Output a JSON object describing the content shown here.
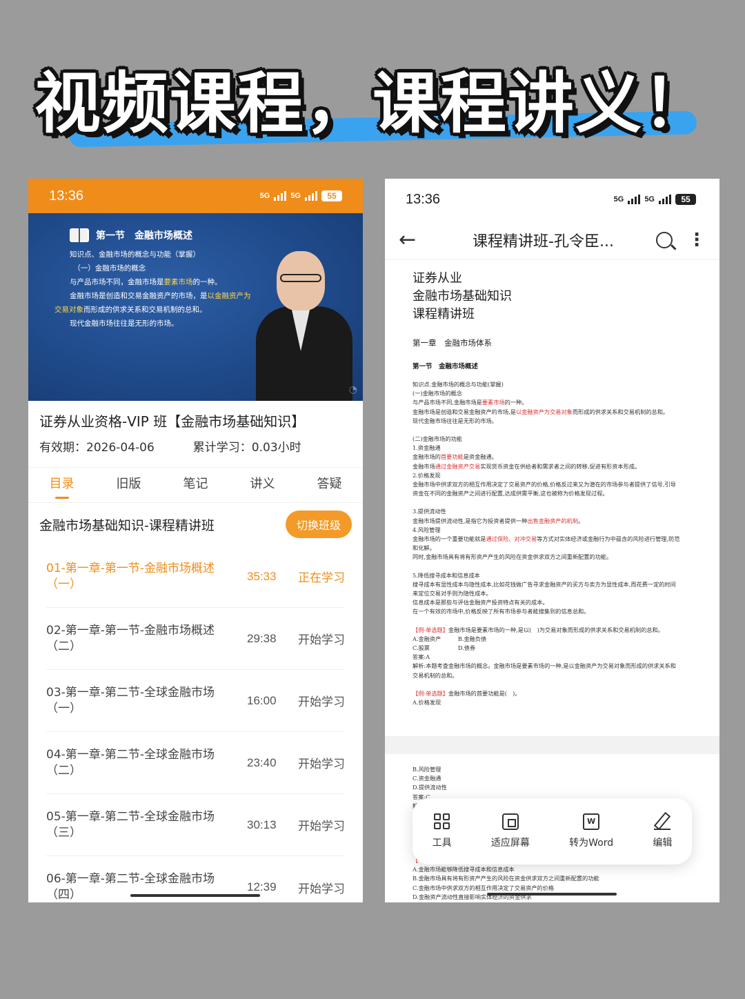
{
  "headline": "视频课程，课程讲义！",
  "left": {
    "status": {
      "time": "13:36",
      "network": "5G",
      "battery": "55"
    },
    "video": {
      "section_title": "第一节　金融市场概述",
      "lines": [
        {
          "pre": "知识点、金融市场的概念与功能（掌握）",
          "hl": "",
          "post": ""
        },
        {
          "pre": "　（一）金融市场的概念",
          "hl": "",
          "post": ""
        },
        {
          "pre": "与产品市场不同，金融市场是",
          "hl": "要素市场",
          "post": "的一种。"
        },
        {
          "pre": "金融市场是创造和交易金融资产的市场，是",
          "hl": "以金融资产为",
          "post": ""
        },
        {
          "pre": "",
          "hl": "交易对象",
          "post": "而形成的供求关系和交易机制的总和。"
        },
        {
          "pre": "现代金融市场往往是无形的市场。",
          "hl": "",
          "post": ""
        }
      ]
    },
    "course": {
      "title": "证券从业资格-VIP 班【金融市场基础知识】",
      "validity": "有效期：2026-04-06",
      "progress": "累计学习：0.03小时"
    },
    "tabs": [
      "目录",
      "旧版",
      "笔记",
      "讲义",
      "答疑"
    ],
    "active_tab": "目录",
    "class_name": "金融市场基础知识-课程精讲班",
    "switch_label": "切换班级",
    "lessons": [
      {
        "name": "01-第一章-第一节-金融市场概述（一）",
        "duration": "35:33",
        "action": "正在学习"
      },
      {
        "name": "02-第一章-第一节-金融市场概述（二）",
        "duration": "29:38",
        "action": "开始学习"
      },
      {
        "name": "03-第一章-第二节-全球金融市场（一）",
        "duration": "16:00",
        "action": "开始学习"
      },
      {
        "name": "04-第一章-第二节-全球金融市场（二）",
        "duration": "23:40",
        "action": "开始学习"
      },
      {
        "name": "05-第一章-第二节-全球金融市场（三）",
        "duration": "30:13",
        "action": "开始学习"
      },
      {
        "name": "06-第一章-第二节-全球金融市场（四）",
        "duration": "12:39",
        "action": "开始学习"
      }
    ]
  },
  "right": {
    "status": {
      "time": "13:36",
      "network": "5G",
      "battery": "55"
    },
    "doc_title": "课程精讲班-孔令臣...",
    "cover": [
      "证券从业",
      "金融市场基础知识",
      "课程精讲班"
    ],
    "chapter": "第一章　金融市场体系",
    "section": "第一节　金融市场概述",
    "body": [
      {
        "pre": "知识点.金融市场的概念与功能(掌握)",
        "red": "",
        "post": ""
      },
      {
        "pre": "(一)金融市场的概念",
        "red": "",
        "post": ""
      },
      {
        "pre": "与产品市场不同,金融市场是",
        "red": "要素市场",
        "post": "的一种。"
      },
      {
        "pre": "金融市场是创造和交易金融资产的市场,是",
        "red": "以金融资产为交易对象",
        "post": "而形成的供求关系和交易机制的总和。"
      },
      {
        "pre": "现代金融市场往往是无形的市场。",
        "red": "",
        "post": ""
      },
      {
        "gap": true
      },
      {
        "pre": "(二)金融市场的功能",
        "red": "",
        "post": ""
      },
      {
        "pre": "1.资金融通",
        "red": "",
        "post": ""
      },
      {
        "pre": "金融市场的",
        "red": "首要功能",
        "post": "是资金融通。"
      },
      {
        "pre": "金融市场",
        "red": "通过金融资产交易",
        "post": "实现货币资金在供给者和需求者之间的转移,促进有形资本形成。"
      },
      {
        "pre": "2.价格发现",
        "red": "",
        "post": ""
      },
      {
        "pre": "金融市场中供求双方的相互作用决定了交易资产的价格,价格反过来又为潜在的市场参与者提供了信号,引导",
        "red": "",
        "post": ""
      },
      {
        "pre": "资金在不同的金融资产之间进行配置,达成供需平衡,这也被称为价格发现过程。",
        "red": "",
        "post": ""
      },
      {
        "gap": true
      },
      {
        "pre": "3.提供流动性",
        "red": "",
        "post": ""
      },
      {
        "pre": "金融市场提供流动性,是指它为投资者提供一种",
        "red": "出售金融资产的机制",
        "post": "。"
      },
      {
        "pre": "4.风险管理",
        "red": "",
        "post": ""
      },
      {
        "pre": "金融市场的一个重要功能就是",
        "red": "通过保险、对冲交易",
        "post": "等方式对实体经济或金融行为中蕴含的风险进行管理,防范"
      },
      {
        "pre": "和化解。",
        "red": "",
        "post": ""
      },
      {
        "pre": "同时,金融市场具有将有形资产产生的风险在资金供求双方之间重新配置的功能。",
        "red": "",
        "post": ""
      },
      {
        "gap": true
      },
      {
        "pre": "5.降低搜寻成本和信息成本",
        "red": "",
        "post": ""
      },
      {
        "pre": "搜寻成本有显性成本与隐性成本,比如花钱做广告寻求金融资产的买方与卖方为显性成本,而花费一定的时间",
        "red": "",
        "post": ""
      },
      {
        "pre": "来定位交易对手则为隐性成本。",
        "red": "",
        "post": ""
      },
      {
        "pre": "信息成本是那些与评估金融资产投资特点有关的成本。",
        "red": "",
        "post": ""
      },
      {
        "pre": "在一个有效的市场中,价格反映了所有市场参与者能搜集到的信息总和。",
        "red": "",
        "post": ""
      },
      {
        "gap": true
      },
      {
        "pre": "",
        "red": "【例-单选题】",
        "post": "金融市场是要素市场的一种,是以(　)为交易对象而形成的供求关系和交易机制的总和。"
      },
      {
        "pre": "A.金融资产　　　B.金融负债",
        "red": "",
        "post": ""
      },
      {
        "pre": "C.股票　　　　　D.债券",
        "red": "",
        "post": ""
      },
      {
        "pre": "答案:A",
        "red": "",
        "post": ""
      },
      {
        "pre": "解析:本题考查金融市场的概念。金融市场是要素市场的一种,是以金融资产为交易对象而形成的供求关系和",
        "red": "",
        "post": ""
      },
      {
        "pre": "交易机制的总和。",
        "red": "",
        "post": ""
      },
      {
        "gap": true
      },
      {
        "pre": "",
        "red": "【例-单选题】",
        "post": "金融市场的首要功能是(　)。"
      },
      {
        "pre": "A.价格发现",
        "red": "",
        "post": ""
      }
    ],
    "page2": [
      "B.风险管理",
      "C.资金融通",
      "D.提供流动性",
      "答案:C",
      "解",
      "",
      "",
      "",
      "",
      "",
      "【",
      "A.金融市场能够降低搜寻成本和信息成本",
      "B.金融市场具有将有形资产产生的风险在资金供求双方之间重新配置的功能",
      "C.金融市场中供求双方的相互作用决定了交易资产的价格",
      "D.金融资产流动性直接影响实体经济的资金供求"
    ],
    "float_bar": [
      "工具",
      "适应屏幕",
      "转为Word",
      "编辑"
    ]
  }
}
